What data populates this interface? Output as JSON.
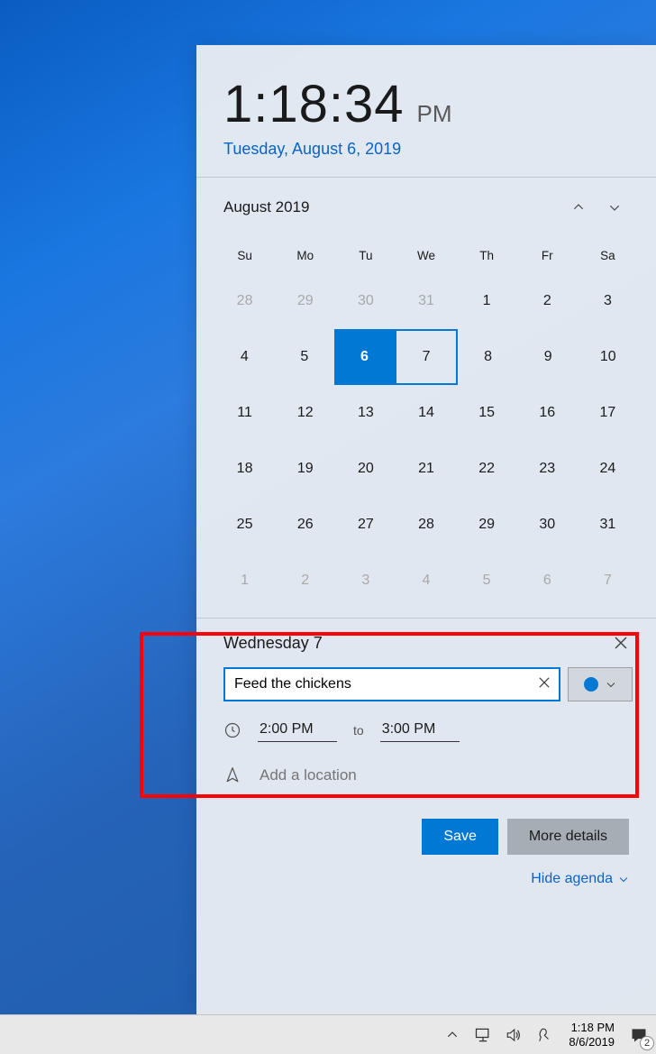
{
  "clock": {
    "time_main": "1:18:34",
    "ampm": "PM",
    "date_long": "Tuesday, August 6, 2019"
  },
  "calendar": {
    "month_label": "August 2019",
    "weekdays": [
      "Su",
      "Mo",
      "Tu",
      "We",
      "Th",
      "Fr",
      "Sa"
    ],
    "grid": [
      [
        {
          "d": "28",
          "muted": true
        },
        {
          "d": "29",
          "muted": true
        },
        {
          "d": "30",
          "muted": true
        },
        {
          "d": "31",
          "muted": true
        },
        {
          "d": "1"
        },
        {
          "d": "2"
        },
        {
          "d": "3"
        }
      ],
      [
        {
          "d": "4"
        },
        {
          "d": "5"
        },
        {
          "d": "6",
          "today": true
        },
        {
          "d": "7",
          "selected": true
        },
        {
          "d": "8"
        },
        {
          "d": "9"
        },
        {
          "d": "10"
        }
      ],
      [
        {
          "d": "11"
        },
        {
          "d": "12"
        },
        {
          "d": "13"
        },
        {
          "d": "14"
        },
        {
          "d": "15"
        },
        {
          "d": "16"
        },
        {
          "d": "17"
        }
      ],
      [
        {
          "d": "18"
        },
        {
          "d": "19"
        },
        {
          "d": "20"
        },
        {
          "d": "21"
        },
        {
          "d": "22"
        },
        {
          "d": "23"
        },
        {
          "d": "24"
        }
      ],
      [
        {
          "d": "25"
        },
        {
          "d": "26"
        },
        {
          "d": "27"
        },
        {
          "d": "28"
        },
        {
          "d": "29"
        },
        {
          "d": "30"
        },
        {
          "d": "31"
        }
      ],
      [
        {
          "d": "1",
          "muted": true
        },
        {
          "d": "2",
          "muted": true
        },
        {
          "d": "3",
          "muted": true
        },
        {
          "d": "4",
          "muted": true
        },
        {
          "d": "5",
          "muted": true
        },
        {
          "d": "6",
          "muted": true
        },
        {
          "d": "7",
          "muted": true
        }
      ]
    ]
  },
  "event": {
    "day_label": "Wednesday 7",
    "title_value": "Feed the chickens",
    "start_time": "2:00 PM",
    "to_label": "to",
    "end_time": "3:00 PM",
    "location_placeholder": "Add a location",
    "calendar_color": "#0078d4"
  },
  "buttons": {
    "save": "Save",
    "more": "More details",
    "hide_agenda": "Hide agenda"
  },
  "taskbar": {
    "time": "1:18 PM",
    "date": "8/6/2019",
    "badge": "2"
  }
}
